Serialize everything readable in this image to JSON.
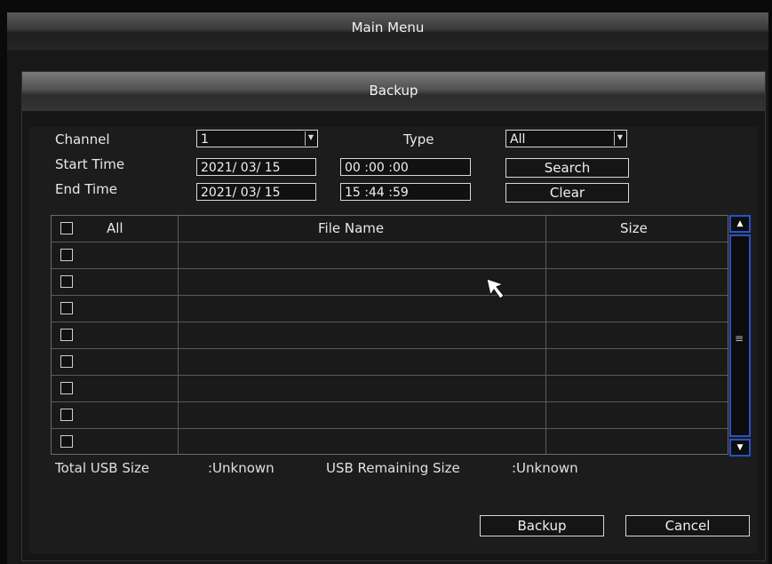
{
  "window": {
    "title": "Main Menu"
  },
  "dialog": {
    "title": "Backup"
  },
  "form": {
    "channel_label": "Channel",
    "channel_value": "1",
    "type_label": "Type",
    "type_value": "All",
    "start_label": "Start Time",
    "start_date": "2021/ 03/ 15",
    "start_time": "00 :00 :00",
    "end_label": "End Time",
    "end_date": "2021/ 03/ 15",
    "end_time": "15 :44 :59",
    "search_label": "Search",
    "clear_label": "Clear"
  },
  "table": {
    "headers": {
      "all": "All",
      "file_name": "File Name",
      "size": "Size"
    },
    "rows": [
      {
        "file_name": "",
        "size": ""
      },
      {
        "file_name": "",
        "size": ""
      },
      {
        "file_name": "",
        "size": ""
      },
      {
        "file_name": "",
        "size": ""
      },
      {
        "file_name": "",
        "size": ""
      },
      {
        "file_name": "",
        "size": ""
      },
      {
        "file_name": "",
        "size": ""
      },
      {
        "file_name": "",
        "size": ""
      }
    ]
  },
  "footer": {
    "total_usb_label": "Total USB Size",
    "total_usb_value": ":Unknown",
    "remaining_label": "USB Remaining Size",
    "remaining_value": ":Unknown",
    "backup_label": "Backup",
    "cancel_label": "Cancel"
  },
  "icons": {
    "dropdown": "chevron-down-icon",
    "scroll_up": "arrow-up-icon",
    "scroll_down": "arrow-down-icon",
    "cursor": "mouse-pointer-icon"
  },
  "colors": {
    "scrollbar_accent": "#2a50c8",
    "background": "#161616"
  }
}
